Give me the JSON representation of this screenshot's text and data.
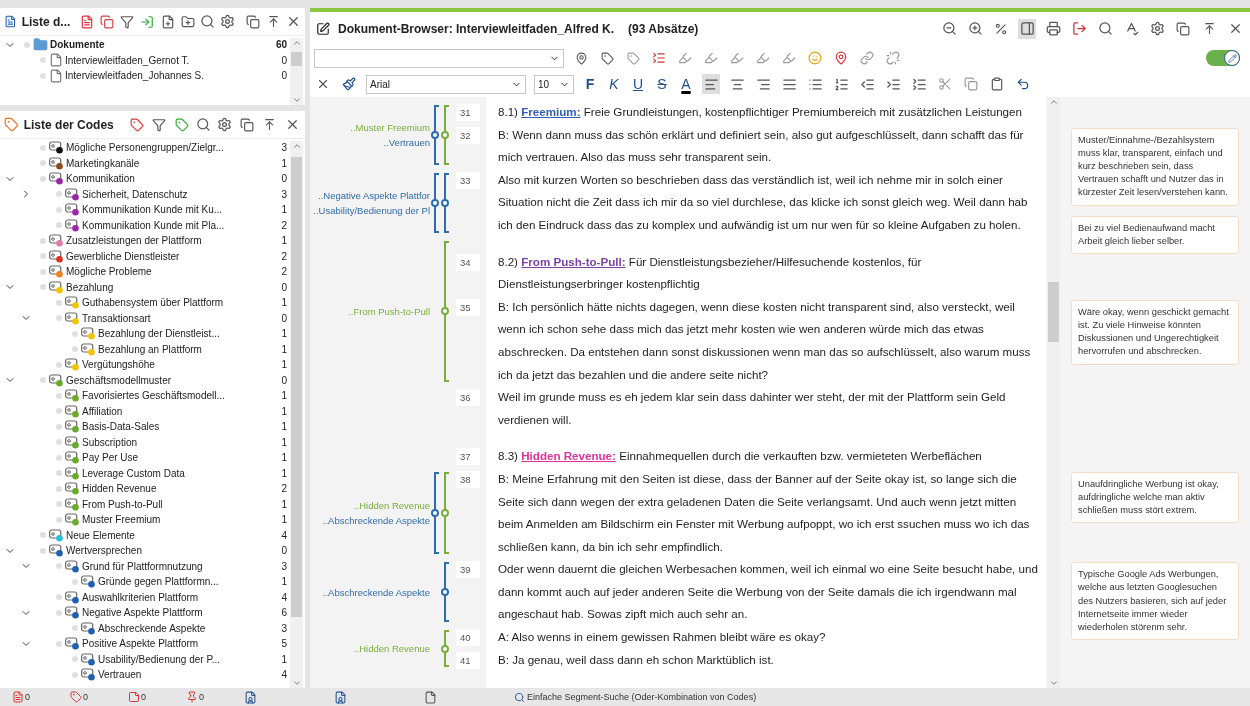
{
  "documents_panel": {
    "title": "Liste d...",
    "root": {
      "name": "Dokumente",
      "count": "60",
      "expanded": true,
      "children": [
        {
          "name": "Interviewleitfaden_Gernot T.",
          "count": "0"
        },
        {
          "name": "Interviewleitfaden_Johannes S.",
          "count": "0"
        }
      ]
    }
  },
  "codes_panel": {
    "title": "Liste der Codes",
    "codes": [
      {
        "name": "Mögliche Personengruppen/Zielgr...",
        "count": "3",
        "color": "#111111"
      },
      {
        "name": "Marketingkanäle",
        "count": "1",
        "color": "#8b4a1c"
      },
      {
        "name": "Kommunikation",
        "count": "0",
        "color": "#9b27af",
        "expanded": true,
        "children": [
          {
            "name": "Sicherheit, Datenschutz",
            "count": "3",
            "color": "#9b27af",
            "expanded": false
          },
          {
            "name": "Kommunikation Kunde mit Ku...",
            "count": "1",
            "color": "#9b27af"
          },
          {
            "name": "Kommunikation Kunde mit Pla...",
            "count": "2",
            "color": "#9b27af"
          }
        ]
      },
      {
        "name": "Zusatzleistungen der Plattform",
        "count": "1",
        "color": "#e07bb0"
      },
      {
        "name": "Gewerbliche Dienstleister",
        "count": "2",
        "color": "#e0321e"
      },
      {
        "name": "Mögliche Probleme",
        "count": "2",
        "color": "#f08020"
      },
      {
        "name": "Bezahlung",
        "count": "0",
        "color": "#f2c500",
        "expanded": true,
        "children": [
          {
            "name": "Guthabensystem über Plattform",
            "count": "1",
            "color": "#f2c500"
          },
          {
            "name": "Transaktionsart",
            "count": "0",
            "color": "#f2c500",
            "expanded": true,
            "children": [
              {
                "name": "Bezahlung der Dienstleist...",
                "count": "1",
                "color": "#f2c500"
              },
              {
                "name": "Bezahlung an Plattform",
                "count": "1",
                "color": "#f2c500"
              }
            ]
          },
          {
            "name": "Vergütungshöhe",
            "count": "1",
            "color": "#f2c500"
          }
        ]
      },
      {
        "name": "Geschäftsmodellmuster",
        "count": "0",
        "color": "#6aaa2a",
        "expanded": true,
        "children": [
          {
            "name": "Favorisiertes Geschäftsmodell...",
            "count": "1",
            "color": "#6aaa2a"
          },
          {
            "name": "Affiliation",
            "count": "1",
            "color": "#6aaa2a"
          },
          {
            "name": "Basis-Data-Sales",
            "count": "1",
            "color": "#6aaa2a"
          },
          {
            "name": "Subscription",
            "count": "1",
            "color": "#6aaa2a"
          },
          {
            "name": "Pay Per Use",
            "count": "1",
            "color": "#6aaa2a"
          },
          {
            "name": "Leverage Custom Data",
            "count": "1",
            "color": "#6aaa2a"
          },
          {
            "name": "Hidden Revenue",
            "count": "2",
            "color": "#6aaa2a"
          },
          {
            "name": "From Push-to-Pull",
            "count": "1",
            "color": "#6aaa2a"
          },
          {
            "name": "Muster Freemium",
            "count": "1",
            "color": "#6aaa2a"
          }
        ]
      },
      {
        "name": "Neue Elemente",
        "count": "4",
        "color": "#26c0d8"
      },
      {
        "name": "Wertversprechen",
        "count": "0",
        "color": "#1f5fb0",
        "expanded": true,
        "children": [
          {
            "name": "Grund für Plattformnutzung",
            "count": "3",
            "color": "#1f5fb0",
            "expanded": true,
            "children": [
              {
                "name": "Gründe gegen Plattformn...",
                "count": "1",
                "color": "#1f5fb0"
              }
            ]
          },
          {
            "name": "Auswahlkriterien Plattform",
            "count": "4",
            "color": "#1f5fb0"
          },
          {
            "name": "Negative Aspekte Plattform",
            "count": "6",
            "color": "#1f5fb0",
            "expanded": true,
            "children": [
              {
                "name": "Abschreckende Aspekte",
                "count": "3",
                "color": "#1f5fb0"
              }
            ]
          },
          {
            "name": "Positive Aspekte Plattform",
            "count": "5",
            "color": "#1f5fb0",
            "expanded": true,
            "children": [
              {
                "name": "Usability/Bedienung der P...",
                "count": "1",
                "color": "#1f5fb0"
              },
              {
                "name": "Vertrauen",
                "count": "4",
                "color": "#1f5fb0"
              }
            ]
          }
        ]
      }
    ]
  },
  "document_browser": {
    "title": "Dokument-Browser: Interviewleitfaden_Alfred K.",
    "paragraph_count": "(93 Absätze)",
    "memo_panel": {
      "selected": true
    },
    "edit_mode": {
      "on": true
    },
    "font": {
      "value": "Arial"
    },
    "font_size": {
      "value": "10"
    },
    "format_buttons": [
      {
        "label": "F",
        "kind": "bold"
      },
      {
        "label": "K",
        "kind": "italic"
      },
      {
        "label": "U",
        "kind": "underline"
      },
      {
        "label": "S",
        "kind": "strike"
      },
      {
        "label": "A",
        "kind": "color"
      }
    ],
    "alignment": [
      {
        "kind": "left",
        "selected": true
      },
      {
        "kind": "center",
        "selected": false
      },
      {
        "kind": "right",
        "selected": false
      },
      {
        "kind": "justify",
        "selected": false
      }
    ],
    "blocks": [
      {
        "codes": [
          {
            "label": "..Muster Freemium",
            "color": "#78ae3c"
          },
          {
            "label": "..Vertrauen",
            "color": "#2f6cad"
          }
        ],
        "paragraphs": [
          {
            "number": "31",
            "kind": "heading",
            "prefix": "8.1)",
            "term": "Freemium:",
            "color": "#2f5fb3",
            "text": "Freie Grundleistungen, kostenpflichtiger Premiumbereich mit zusätzlichen Leistungen"
          },
          {
            "number": "32",
            "kind": "text",
            "text": "B: Wenn dann muss das schön erklärt und definiert sein, also gut aufgeschlüsselt, dann schafft das für mich vertrauen. Also das muss sehr transparent sein.",
            "memos": [
              "Muster/Einnahme-/Bezahlsystem muss klar, transparent, einfach und kurz beschrieben sein, dass Vertrauen schafft und Nutzer das in kürzester Zeit lesen/verstehen kann.",
              "Bei zu viel Bedienaufwand macht Arbeit gleich lieber selber."
            ]
          }
        ]
      },
      {
        "codes": [
          {
            "label": "..Negative Aspekte Plattfor",
            "color": "#2f6cad"
          },
          {
            "label": "..Usability/Bedienung der Pl",
            "color": "#2f6cad"
          }
        ],
        "paragraphs": [
          {
            "number": "33",
            "kind": "text",
            "text": "Also mit kurzen Worten so beschrieben dass das verständlich ist, weil ich nehme mir in solch einer Situation nicht die Zeit dass ich mir da so viel durchlese, das klicke ich sonst gleich weg. Weil dann hab ich den Eindruck dass das zu komplex und aufwändig ist um nur wen für so kleine Aufgaben zu holen."
          }
        ]
      },
      {
        "codes": [
          {
            "label": "..From Push-to-Pull",
            "color": "#78ae3c"
          }
        ],
        "paragraphs": [
          {
            "number": "34",
            "kind": "heading",
            "prefix": "8.2)",
            "term": "From Push-to-Pull:",
            "color": "#7b3fa8",
            "text": "Für Dienstleistungsbezieher/Hilfesuchende kostenlos, für Dienstleistungserbringer kostenpflichtig"
          },
          {
            "number": "35",
            "kind": "text",
            "text": "B: Ich persönlich hätte nichts dagegen, wenn diese kosten nicht transparent sind, also versteckt, weil wenn ich schon sehe dass mich das jetzt mehr kosten wie wen anderen würde mich das etwas abschrecken. Da entstehen dann sonst diskussionen wenn man das so aufschlüsselt, also warum muss ich da jetzt das bezahlen und die andere seite nicht?",
            "memos": [
              "Wäre okay, wenn geschickt gemacht ist. Zu viele Hinweise könnten Diskussionen und Ungerechtigkeit hervorrufen und abschrecken."
            ]
          }
        ]
      },
      {
        "paragraphs": [
          {
            "number": "36",
            "kind": "text",
            "text": "Weil im grunde muss es eh jedem klar sein dass dahinter wer steht, der mit der Plattform sein Geld verdienen will."
          },
          {
            "number": "37",
            "kind": "heading",
            "prefix": "8.3)",
            "term": "Hidden Revenue:",
            "color": "#e0329a",
            "text": "Einnahmequellen durch die verkauften bzw. vermieteten Werbeflächen"
          }
        ]
      },
      {
        "codes": [
          {
            "label": "..Hidden Revenue",
            "color": "#78ae3c"
          },
          {
            "label": "..Abschreckende Aspekte",
            "color": "#2f6cad"
          }
        ],
        "paragraphs": [
          {
            "number": "38",
            "kind": "text",
            "text": "B: Meine Erfahrung mit den Seiten ist diese, dass der Banner auf der Seite okay ist, so lange sich die Seite sich dann wegen der extra geladenen Daten die Seite verlangsamt. Und auch wenn jetzt mitten beim Anmelden am Bildschirm ein Fenster mit Werbung aufpoppt, wo ich erst ssuchen muss wo ich das schließen kann, da bin ich sehr empfindlich.",
            "memos": [
              "Unaufdringliche Werbung ist okay, aufdringliche welche man aktiv schließen muss stört extrem."
            ]
          }
        ]
      },
      {
        "codes": [
          {
            "label": "..Abschreckende Aspekte",
            "color": "#2f6cad"
          }
        ],
        "paragraphs": [
          {
            "number": "39",
            "kind": "text",
            "text": "Oder wenn dauernt die gleichen Werbesachen kommen, weil ich einmal wo eine Seite besucht habe, und dann kommt auch auf jeder anderen Seite die Werbung von der Seite damals die ich irgendwann mal angeschaut hab. Sowas zipft mich auch sehr an.",
            "memos": [
              "Typische Google Ads Werbungen, welche aus letzten Googlesuchen des Nutzers basieren, sich auf jeder Internetseite immer wieder wiederholen störenm sehr."
            ]
          }
        ]
      },
      {
        "codes": [
          {
            "label": "..Hidden Revenue",
            "color": "#78ae3c"
          }
        ],
        "paragraphs": [
          {
            "number": "40",
            "kind": "text",
            "text": "A: Also wenns in einem gewissen Rahmen bleibt wäre es okay?"
          },
          {
            "number": "41",
            "kind": "text",
            "text": "B: Ja genau, weil dass dann eh schon Marktüblich ist."
          }
        ]
      }
    ]
  },
  "status_bar": {
    "counters": [
      {
        "kind": "documents",
        "count": "0"
      },
      {
        "kind": "codes",
        "count": "0"
      },
      {
        "kind": "memos",
        "count": "0"
      },
      {
        "kind": "variables",
        "count": "0"
      }
    ],
    "search_mode": "Einfache Segment-Suche (Oder-Kombination von Codes)"
  }
}
